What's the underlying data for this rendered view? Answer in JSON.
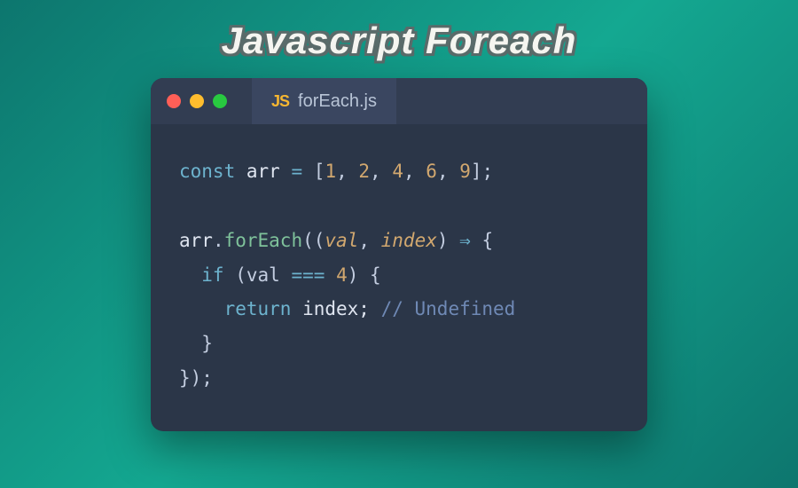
{
  "header": {
    "title": "Javascript Foreach"
  },
  "window": {
    "traffic_lights": {
      "close": "close",
      "minimize": "minimize",
      "maximize": "maximize"
    },
    "tab": {
      "language_badge": "JS",
      "filename": "forEach.js"
    }
  },
  "code": {
    "l1_const": "const",
    "l1_var": "arr",
    "l1_eq": "=",
    "l1_open": "[",
    "l1_n1": "1",
    "l1_n2": "2",
    "l1_n3": "4",
    "l1_n4": "6",
    "l1_n5": "9",
    "l1_close": "];",
    "l1_comma": ", ",
    "l3_obj": "arr",
    "l3_dot": ".",
    "l3_fn": "forEach",
    "l3_paren_open": "((",
    "l3_arg1": "val",
    "l3_argsep": ", ",
    "l3_arg2": "index",
    "l3_paren_close": ")",
    "l3_arrow": "⇒",
    "l3_brace": "{",
    "l4_if": "if",
    "l4_open": "(val",
    "l4_eq": "===",
    "l4_num": "4",
    "l4_close": ") {",
    "l5_return": "return",
    "l5_var": "index;",
    "l5_comment": "// Undefined",
    "l6_close": "}",
    "l7_close": "});"
  }
}
